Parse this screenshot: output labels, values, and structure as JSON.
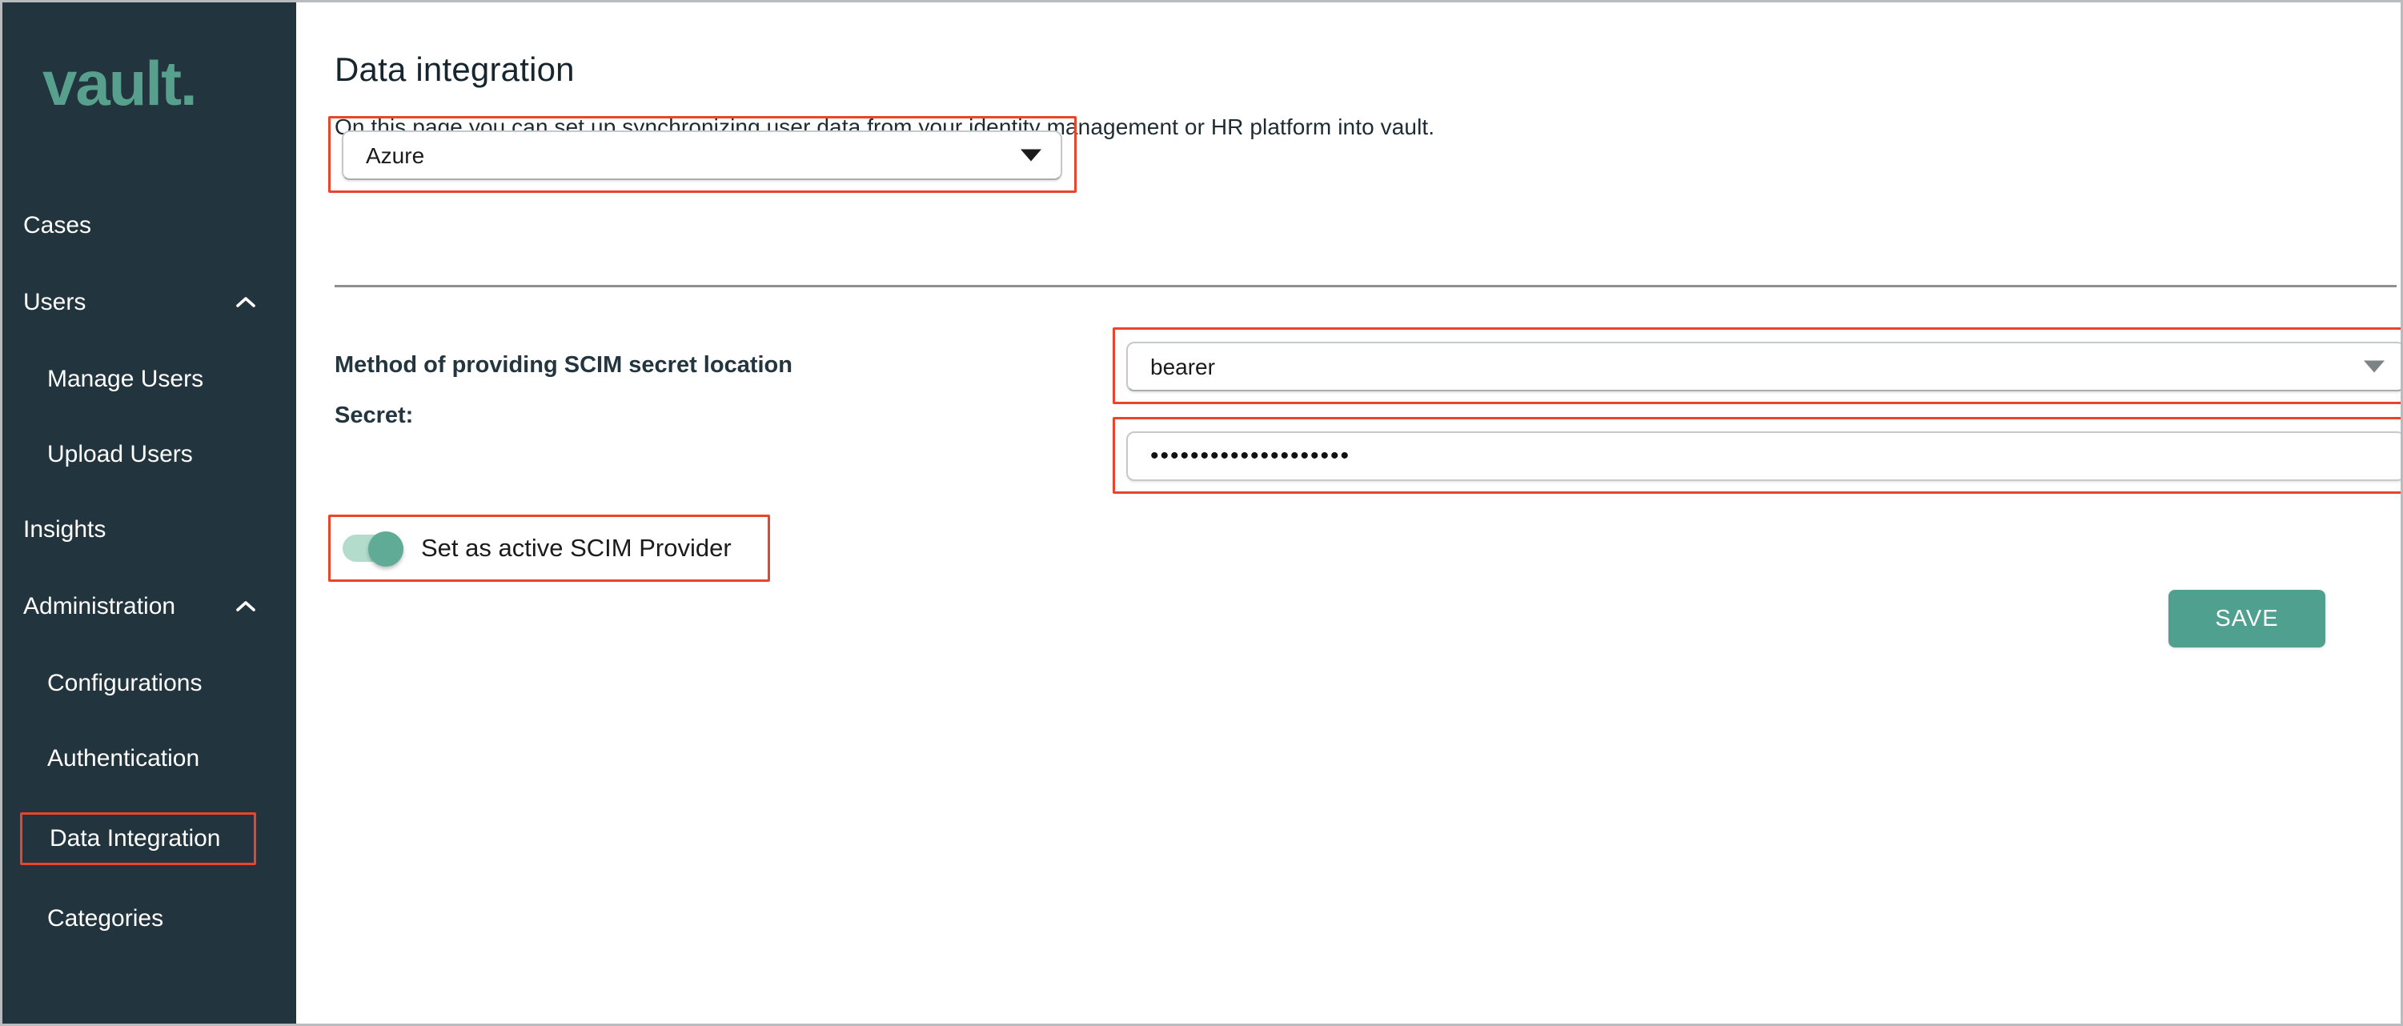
{
  "sidebar": {
    "logo": "vault.",
    "items": [
      {
        "label": "Cases",
        "type": "top",
        "icon": null,
        "highlighted": false
      },
      {
        "label": "Users",
        "type": "top",
        "icon": "chevron-up-icon",
        "highlighted": false
      },
      {
        "label": "Manage Users",
        "type": "sub",
        "icon": null,
        "highlighted": false
      },
      {
        "label": "Upload Users",
        "type": "sub",
        "icon": null,
        "highlighted": false
      },
      {
        "label": "Insights",
        "type": "top",
        "icon": null,
        "highlighted": false
      },
      {
        "label": "Administration",
        "type": "top",
        "icon": "chevron-up-icon",
        "highlighted": false
      },
      {
        "label": "Configurations",
        "type": "sub",
        "icon": null,
        "highlighted": false
      },
      {
        "label": "Authentication",
        "type": "sub",
        "icon": null,
        "highlighted": false
      },
      {
        "label": "Data Integration",
        "type": "sub",
        "icon": null,
        "highlighted": true
      },
      {
        "label": "Categories",
        "type": "sub",
        "icon": null,
        "highlighted": false
      }
    ]
  },
  "main": {
    "title": "Data integration",
    "description": "On this page you can set up synchronizing user data from your identity management or HR platform into vault.",
    "provider_select": {
      "value": "Azure",
      "options": [
        "Azure"
      ],
      "icon": "chevron-down-icon"
    },
    "scim_method": {
      "label": "Method of providing SCIM secret location",
      "value": "bearer",
      "options": [
        "bearer"
      ],
      "icon": "chevron-down-icon"
    },
    "secret": {
      "label": "Secret:",
      "value": "••••••••••••••••••••",
      "placeholder": ""
    },
    "active_provider_toggle": {
      "label": "Set as active SCIM Provider",
      "checked": true
    },
    "save_label": "SAVE"
  },
  "colors": {
    "sidebar_bg": "#22343d",
    "logo_green": "#56a08d",
    "accent_green": "#50a08f",
    "toggle_track": "#b3dccd",
    "toggle_thumb": "#60ab95",
    "annotation_red": "#e8452a",
    "label_navy": "#23353e",
    "divider_grey": "#8d9194"
  }
}
